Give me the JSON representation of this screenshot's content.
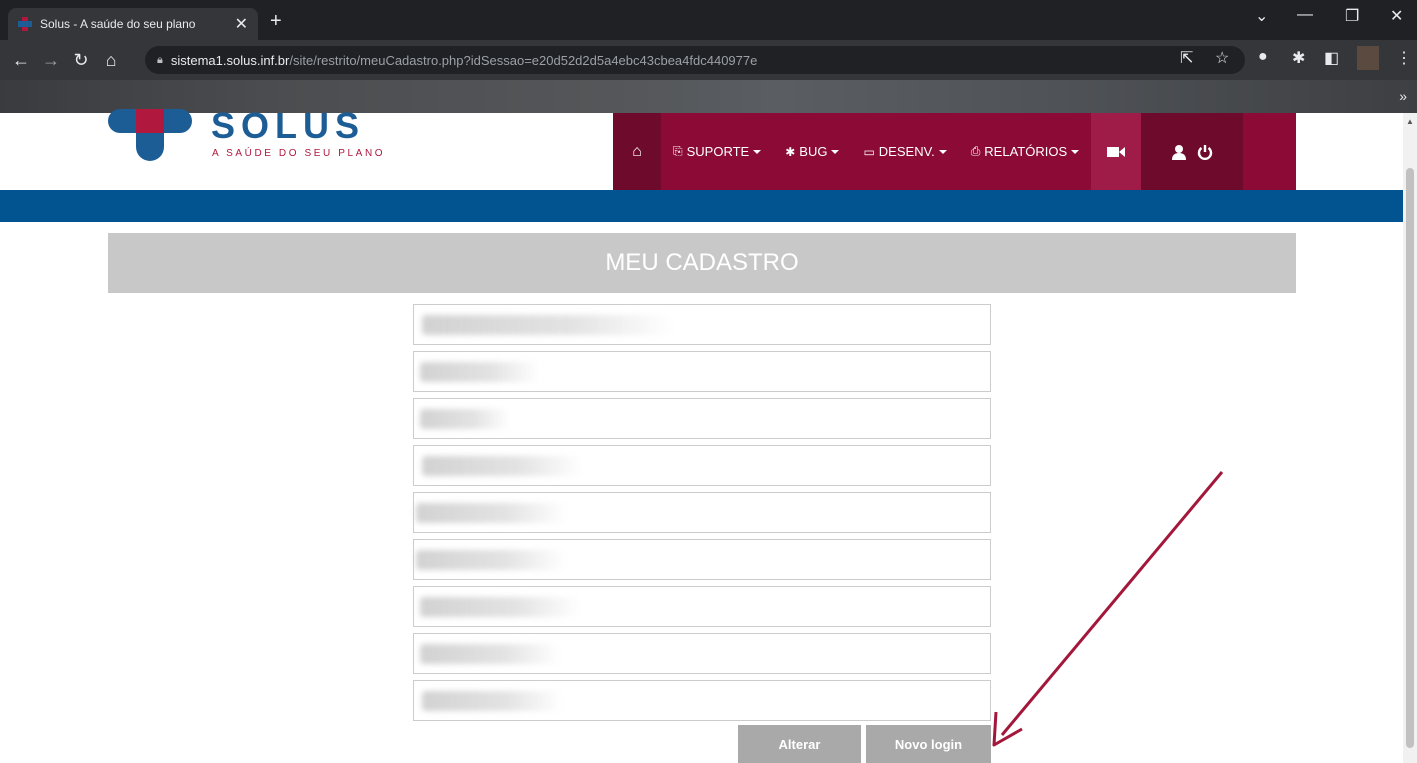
{
  "browser": {
    "tab_title": "Solus - A saúde do seu plano",
    "tab_close": "✕",
    "new_tab": "+",
    "url_host": "sistema1.solus.inf.br",
    "url_path": "/site/restrito/meuCadastro.php?idSessao=e20d52d2d5a4ebc43cbea4fdc440977e",
    "bookmarks_more": "»"
  },
  "logo": {
    "name": "SOLUS",
    "tagline": "A SAÚDE DO SEU PLANO"
  },
  "nav": {
    "suporte": "SUPORTE",
    "bug": "BUG",
    "desenv": "DESENV.",
    "relatorios": "RELATÓRIOS"
  },
  "page": {
    "title": "MEU CADASTRO"
  },
  "fields": [
    {
      "name": "field-1"
    },
    {
      "name": "field-2"
    },
    {
      "name": "field-3"
    },
    {
      "name": "field-4"
    },
    {
      "name": "field-5"
    },
    {
      "name": "field-6"
    },
    {
      "name": "field-7"
    },
    {
      "name": "field-8"
    },
    {
      "name": "field-9"
    }
  ],
  "buttons": {
    "alterar": "Alterar",
    "novo_login": "Novo login"
  },
  "colors": {
    "brand_red": "#8b0a36",
    "brand_blue": "#01548f",
    "arrow": "#a3183a"
  }
}
